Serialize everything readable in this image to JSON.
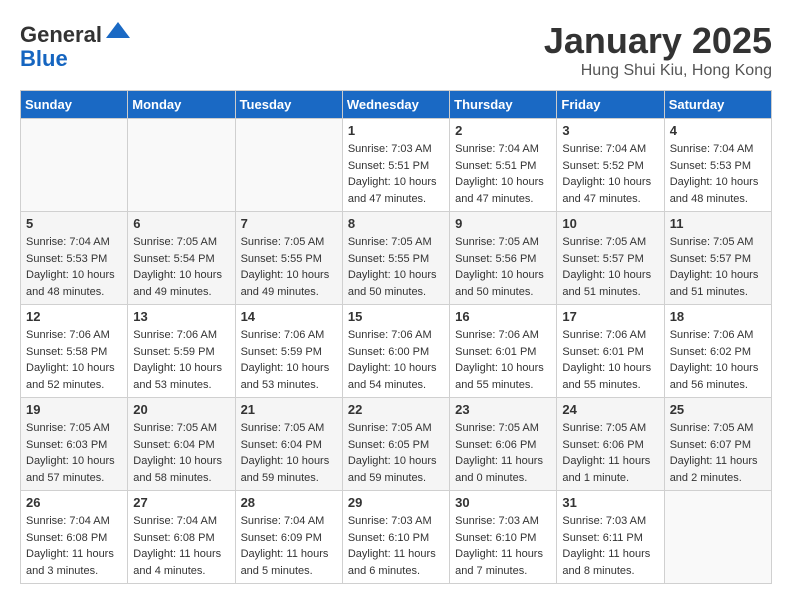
{
  "header": {
    "logo_line1": "General",
    "logo_line2": "Blue",
    "title": "January 2025",
    "subtitle": "Hung Shui Kiu, Hong Kong"
  },
  "days_of_week": [
    "Sunday",
    "Monday",
    "Tuesday",
    "Wednesday",
    "Thursday",
    "Friday",
    "Saturday"
  ],
  "weeks": [
    [
      {
        "day": "",
        "info": ""
      },
      {
        "day": "",
        "info": ""
      },
      {
        "day": "",
        "info": ""
      },
      {
        "day": "1",
        "info": "Sunrise: 7:03 AM\nSunset: 5:51 PM\nDaylight: 10 hours\nand 47 minutes."
      },
      {
        "day": "2",
        "info": "Sunrise: 7:04 AM\nSunset: 5:51 PM\nDaylight: 10 hours\nand 47 minutes."
      },
      {
        "day": "3",
        "info": "Sunrise: 7:04 AM\nSunset: 5:52 PM\nDaylight: 10 hours\nand 47 minutes."
      },
      {
        "day": "4",
        "info": "Sunrise: 7:04 AM\nSunset: 5:53 PM\nDaylight: 10 hours\nand 48 minutes."
      }
    ],
    [
      {
        "day": "5",
        "info": "Sunrise: 7:04 AM\nSunset: 5:53 PM\nDaylight: 10 hours\nand 48 minutes."
      },
      {
        "day": "6",
        "info": "Sunrise: 7:05 AM\nSunset: 5:54 PM\nDaylight: 10 hours\nand 49 minutes."
      },
      {
        "day": "7",
        "info": "Sunrise: 7:05 AM\nSunset: 5:55 PM\nDaylight: 10 hours\nand 49 minutes."
      },
      {
        "day": "8",
        "info": "Sunrise: 7:05 AM\nSunset: 5:55 PM\nDaylight: 10 hours\nand 50 minutes."
      },
      {
        "day": "9",
        "info": "Sunrise: 7:05 AM\nSunset: 5:56 PM\nDaylight: 10 hours\nand 50 minutes."
      },
      {
        "day": "10",
        "info": "Sunrise: 7:05 AM\nSunset: 5:57 PM\nDaylight: 10 hours\nand 51 minutes."
      },
      {
        "day": "11",
        "info": "Sunrise: 7:05 AM\nSunset: 5:57 PM\nDaylight: 10 hours\nand 51 minutes."
      }
    ],
    [
      {
        "day": "12",
        "info": "Sunrise: 7:06 AM\nSunset: 5:58 PM\nDaylight: 10 hours\nand 52 minutes."
      },
      {
        "day": "13",
        "info": "Sunrise: 7:06 AM\nSunset: 5:59 PM\nDaylight: 10 hours\nand 53 minutes."
      },
      {
        "day": "14",
        "info": "Sunrise: 7:06 AM\nSunset: 5:59 PM\nDaylight: 10 hours\nand 53 minutes."
      },
      {
        "day": "15",
        "info": "Sunrise: 7:06 AM\nSunset: 6:00 PM\nDaylight: 10 hours\nand 54 minutes."
      },
      {
        "day": "16",
        "info": "Sunrise: 7:06 AM\nSunset: 6:01 PM\nDaylight: 10 hours\nand 55 minutes."
      },
      {
        "day": "17",
        "info": "Sunrise: 7:06 AM\nSunset: 6:01 PM\nDaylight: 10 hours\nand 55 minutes."
      },
      {
        "day": "18",
        "info": "Sunrise: 7:06 AM\nSunset: 6:02 PM\nDaylight: 10 hours\nand 56 minutes."
      }
    ],
    [
      {
        "day": "19",
        "info": "Sunrise: 7:05 AM\nSunset: 6:03 PM\nDaylight: 10 hours\nand 57 minutes."
      },
      {
        "day": "20",
        "info": "Sunrise: 7:05 AM\nSunset: 6:04 PM\nDaylight: 10 hours\nand 58 minutes."
      },
      {
        "day": "21",
        "info": "Sunrise: 7:05 AM\nSunset: 6:04 PM\nDaylight: 10 hours\nand 59 minutes."
      },
      {
        "day": "22",
        "info": "Sunrise: 7:05 AM\nSunset: 6:05 PM\nDaylight: 10 hours\nand 59 minutes."
      },
      {
        "day": "23",
        "info": "Sunrise: 7:05 AM\nSunset: 6:06 PM\nDaylight: 11 hours\nand 0 minutes."
      },
      {
        "day": "24",
        "info": "Sunrise: 7:05 AM\nSunset: 6:06 PM\nDaylight: 11 hours\nand 1 minute."
      },
      {
        "day": "25",
        "info": "Sunrise: 7:05 AM\nSunset: 6:07 PM\nDaylight: 11 hours\nand 2 minutes."
      }
    ],
    [
      {
        "day": "26",
        "info": "Sunrise: 7:04 AM\nSunset: 6:08 PM\nDaylight: 11 hours\nand 3 minutes."
      },
      {
        "day": "27",
        "info": "Sunrise: 7:04 AM\nSunset: 6:08 PM\nDaylight: 11 hours\nand 4 minutes."
      },
      {
        "day": "28",
        "info": "Sunrise: 7:04 AM\nSunset: 6:09 PM\nDaylight: 11 hours\nand 5 minutes."
      },
      {
        "day": "29",
        "info": "Sunrise: 7:03 AM\nSunset: 6:10 PM\nDaylight: 11 hours\nand 6 minutes."
      },
      {
        "day": "30",
        "info": "Sunrise: 7:03 AM\nSunset: 6:10 PM\nDaylight: 11 hours\nand 7 minutes."
      },
      {
        "day": "31",
        "info": "Sunrise: 7:03 AM\nSunset: 6:11 PM\nDaylight: 11 hours\nand 8 minutes."
      },
      {
        "day": "",
        "info": ""
      }
    ]
  ]
}
